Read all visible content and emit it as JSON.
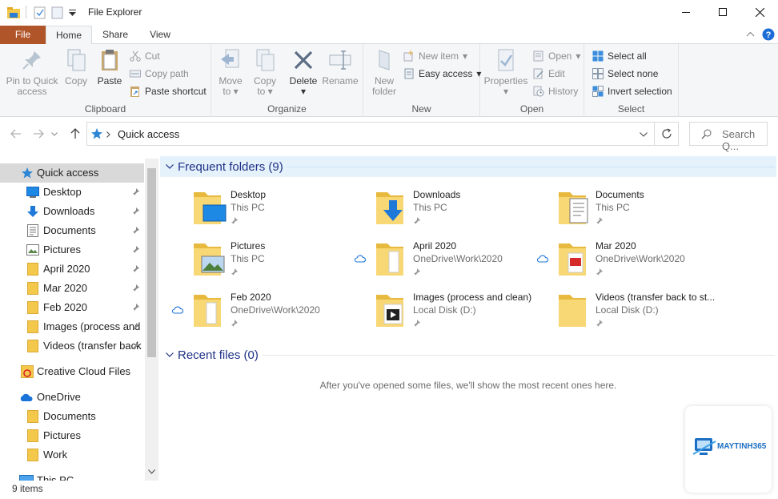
{
  "window": {
    "title": "File Explorer"
  },
  "tabs": {
    "file": "File",
    "home": "Home",
    "share": "Share",
    "view": "View"
  },
  "ribbon": {
    "clipboard": {
      "label": "Clipboard",
      "pin": [
        "Pin to Quick",
        "access"
      ],
      "copy": "Copy",
      "paste": "Paste",
      "cut": "Cut",
      "copy_path": "Copy path",
      "paste_shortcut": "Paste shortcut"
    },
    "organize": {
      "label": "Organize",
      "move_to": [
        "Move",
        "to"
      ],
      "copy_to": [
        "Copy",
        "to"
      ],
      "delete": "Delete",
      "rename": "Rename"
    },
    "new": {
      "label": "New",
      "new_folder": [
        "New",
        "folder"
      ],
      "new_item": "New item",
      "easy_access": "Easy access"
    },
    "open": {
      "label": "Open",
      "properties": "Properties",
      "open": "Open",
      "edit": "Edit",
      "history": "History"
    },
    "select": {
      "label": "Select",
      "select_all": "Select all",
      "select_none": "Select none",
      "invert": "Invert selection"
    }
  },
  "address": {
    "path": "Quick access",
    "search_placeholder": "Search Q..."
  },
  "nav": {
    "quick_access": "Quick access",
    "items": [
      {
        "label": "Desktop",
        "icon": "desktop-icon"
      },
      {
        "label": "Downloads",
        "icon": "download-icon"
      },
      {
        "label": "Documents",
        "icon": "document-icon"
      },
      {
        "label": "Pictures",
        "icon": "pictures-icon"
      },
      {
        "label": "April 2020",
        "icon": "folder-icon"
      },
      {
        "label": "Mar 2020",
        "icon": "folder-icon"
      },
      {
        "label": "Feb 2020",
        "icon": "folder-icon"
      },
      {
        "label": "Images (process and",
        "icon": "folder-icon"
      },
      {
        "label": "Videos (transfer back",
        "icon": "folder-icon"
      }
    ],
    "creative_cloud": "Creative Cloud Files",
    "onedrive": "OneDrive",
    "onedrive_items": [
      "Documents",
      "Pictures",
      "Work"
    ],
    "this_pc": "This PC"
  },
  "frequent": {
    "title": "Frequent folders (9)",
    "folders": [
      {
        "name": "Desktop",
        "location": "This PC"
      },
      {
        "name": "Downloads",
        "location": "This PC"
      },
      {
        "name": "Documents",
        "location": "This PC"
      },
      {
        "name": "Pictures",
        "location": "This PC"
      },
      {
        "name": "April 2020",
        "location": "OneDrive\\Work\\2020"
      },
      {
        "name": "Mar 2020",
        "location": "OneDrive\\Work\\2020"
      },
      {
        "name": "Feb 2020",
        "location": "OneDrive\\Work\\2020"
      },
      {
        "name": "Images (process and clean)",
        "location": "Local Disk (D:)"
      },
      {
        "name": "Videos (transfer back to st...",
        "location": "Local Disk (D:)"
      }
    ]
  },
  "recent": {
    "title": "Recent files (0)",
    "empty_message": "After you've opened some files, we'll show the most recent ones here."
  },
  "status": {
    "items": "9 items"
  },
  "watermark": {
    "text": "MAYTINH365"
  },
  "colors": {
    "file_tab": "#b0552a",
    "accent": "#1e3287",
    "folder": "#f4c84a",
    "selection": "#d9d9d9"
  }
}
